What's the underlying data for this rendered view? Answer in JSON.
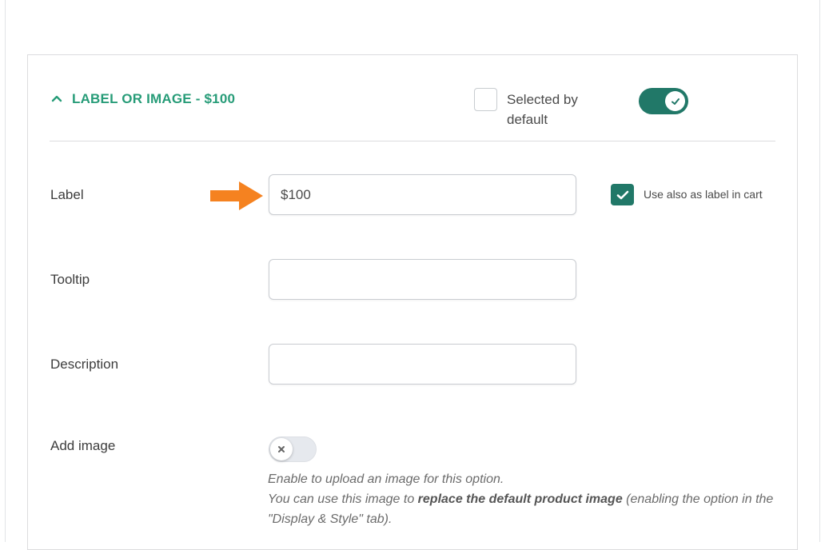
{
  "option": {
    "title": "LABEL OR IMAGE - $100",
    "selected_default_label": "Selected by default",
    "selected_default_checked": false,
    "enabled": true
  },
  "fields": {
    "label": {
      "label": "Label",
      "value": "$100",
      "use_cart_label": "Use also as label in cart",
      "use_cart_checked": true
    },
    "tooltip": {
      "label": "Tooltip",
      "value": ""
    },
    "description": {
      "label": "Description",
      "value": ""
    },
    "add_image": {
      "label": "Add image",
      "enabled": false,
      "help_line1": "Enable to upload an image for this option.",
      "help_line2_pre": "You can use this image to ",
      "help_line2_bold": "replace the default product image",
      "help_line2_post": " (enabling the option in the \"Display & Style\" tab)."
    }
  },
  "colors": {
    "accent": "#279c78",
    "toggle_on": "#217868",
    "arrow": "#f58220"
  },
  "icons": {
    "collapse": "chevron-up-icon",
    "toggle_on_knob": "check-icon",
    "cart_checkbox": "check-icon",
    "toggle_off_knob": "x-icon",
    "pointer": "arrow-right-icon"
  }
}
